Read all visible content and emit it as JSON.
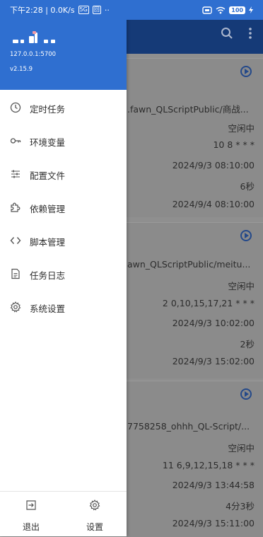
{
  "status_bar": {
    "left_text": "下午2:28 | 0.0K/s",
    "network_badge": "5G",
    "app_badge": "回",
    "more": "··",
    "battery": "100"
  },
  "drawer": {
    "host": "127.0.0.1:5700",
    "version": "v2.15.9",
    "menu": [
      {
        "label": "定时任务",
        "icon": "clock-icon"
      },
      {
        "label": "环境变量",
        "icon": "key-icon"
      },
      {
        "label": "配置文件",
        "icon": "sliders-icon"
      },
      {
        "label": "依赖管理",
        "icon": "puzzle-icon"
      },
      {
        "label": "脚本管理",
        "icon": "code-icon"
      },
      {
        "label": "任务日志",
        "icon": "document-icon"
      },
      {
        "label": "系统设置",
        "icon": "gear-icon"
      }
    ],
    "footer": {
      "logout_label": "退出",
      "settings_label": "设置"
    }
  },
  "background_tasks": [
    {
      "path": ".fawn_QLScriptPublic/商战...",
      "status": "空闲中",
      "schedule": "10 8 * * *",
      "last_run": "2024/9/3 08:10:00",
      "duration": "6秒",
      "next_run": "2024/9/4 08:10:00"
    },
    {
      "path": "awn_QLScriptPublic/meitu...",
      "status": "空闲中",
      "schedule": "2 0,10,15,17,21 * * *",
      "last_run": "2024/9/3 10:02:00",
      "duration": "2秒",
      "next_run": "2024/9/3 15:02:00"
    },
    {
      "path": "7758258_ohhh_QL-Script/...",
      "status": "空闲中",
      "schedule": "11 6,9,12,15,18 * * *",
      "last_run": "2024/9/3 13:44:58",
      "duration": "4分3秒",
      "next_run": "2024/9/3 15:11:00"
    }
  ]
}
